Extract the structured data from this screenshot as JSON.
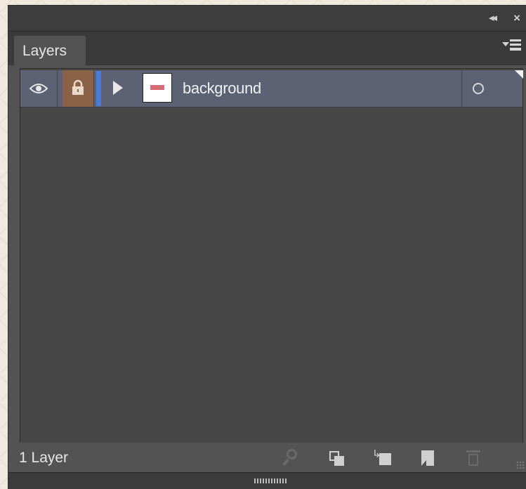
{
  "panel": {
    "title_buttons": {
      "collapse": "◂◂",
      "close": "×"
    },
    "tab": {
      "label": "Layers"
    },
    "menu_icon": "panel-menu-icon"
  },
  "layers": [
    {
      "name": "background",
      "visible": true,
      "locked": true,
      "color": "#4b7bd9",
      "expanded": false,
      "thumbnail_icon": "layer-thumbnail"
    }
  ],
  "footer": {
    "count_label": "1 Layer",
    "buttons": [
      {
        "icon": "locate-object-icon",
        "enabled": false
      },
      {
        "icon": "clipping-mask-icon",
        "enabled": true
      },
      {
        "icon": "new-sublayer-icon",
        "enabled": true
      },
      {
        "icon": "new-layer-icon",
        "enabled": true
      },
      {
        "icon": "trash-icon",
        "enabled": false
      }
    ]
  },
  "colors": {
    "panel_bg": "#535353",
    "list_bg": "#474747",
    "selected_row": "#5a6273",
    "lock_highlight": "#8b6247",
    "layer_color": "#4b7bd9"
  }
}
